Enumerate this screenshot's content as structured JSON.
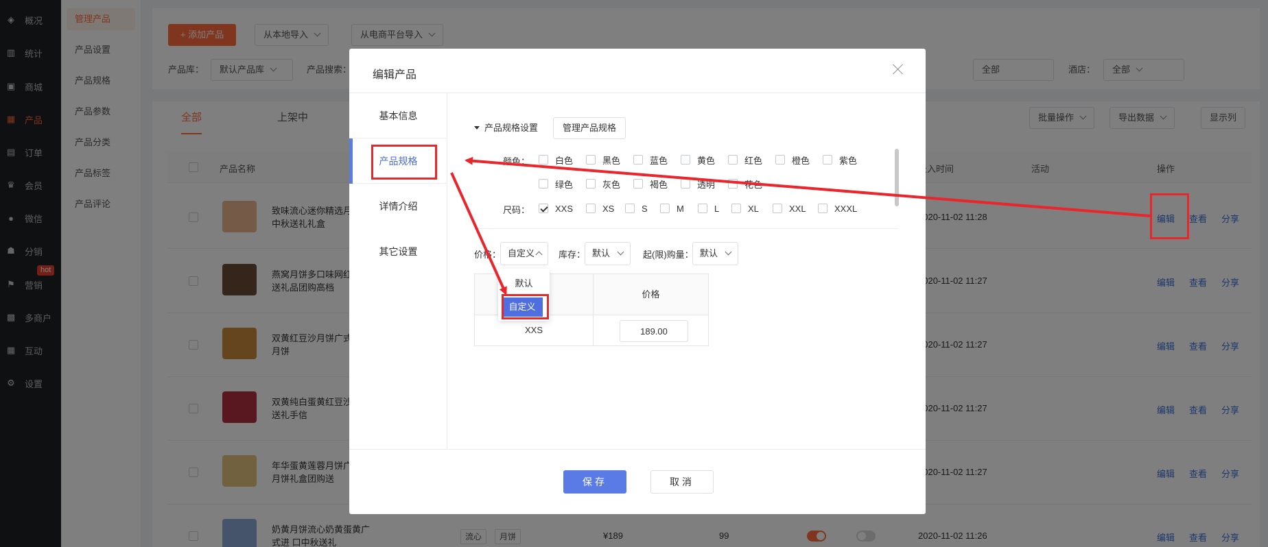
{
  "sidebar": {
    "items": [
      {
        "label": "概况",
        "icon": "layers-icon"
      },
      {
        "label": "统计",
        "icon": "chart-icon"
      },
      {
        "label": "商城",
        "icon": "shop-icon"
      },
      {
        "label": "产品",
        "icon": "grid-icon"
      },
      {
        "label": "订单",
        "icon": "order-icon"
      },
      {
        "label": "会员",
        "icon": "crown-icon"
      },
      {
        "label": "微信",
        "icon": "wechat-icon"
      },
      {
        "label": "分销",
        "icon": "users-icon"
      },
      {
        "label": "营销",
        "icon": "flag-icon"
      },
      {
        "label": "多商户",
        "icon": "store-icon"
      },
      {
        "label": "互动",
        "icon": "grid-icon"
      },
      {
        "label": "设置",
        "icon": "gear-icon"
      }
    ],
    "hot_badge": "hot"
  },
  "subnav": {
    "items": [
      "管理产品",
      "产品设置",
      "产品规格",
      "产品参数",
      "产品分类",
      "产品标签",
      "产品评论"
    ]
  },
  "toolbar": {
    "add_label": "+ 添加产品",
    "import_local": "从本地导入",
    "import_ecom": "从电商平台导入"
  },
  "filters": {
    "lib_label": "产品库：",
    "lib_value": "默认产品库",
    "search_label": "产品搜索：",
    "all_value": "全部",
    "hotel_label": "酒店：",
    "hotel_value": "全部"
  },
  "tabs": [
    "全部",
    "上架中"
  ],
  "list_actions": {
    "batch": "批量操作",
    "export": "导出数据",
    "columns": "显示列"
  },
  "table": {
    "headers": {
      "name": "产品名称",
      "time": "录入时间",
      "activity": "活动",
      "ops": "操作"
    },
    "time_prefix_hidden": "录",
    "rows": [
      {
        "name": "致味流心迷你精选月饼 蓉中秋送礼礼盒",
        "time": "2020-11-02 11:28"
      },
      {
        "name": "燕窝月饼多口味网红 月饼送礼品团购高档",
        "time": "2020-11-02 11:27"
      },
      {
        "name": "双黄红豆沙月饼广式 中秋月饼",
        "time": "2020-11-02 11:27"
      },
      {
        "name": "双黄纯白蛋黄红豆沙 中秋送礼手信",
        "time": "2020-11-02 11:27"
      },
      {
        "name": "年华蛋黄莲蓉月饼广 中秋月饼礼盒团购送",
        "time": "2020-11-02 11:27"
      },
      {
        "name": "奶黄月饼流心奶黄蛋黄广式进 口中秋送礼",
        "time": "2020-11-02 11:26",
        "tags": [
          "流心",
          "月饼"
        ],
        "price": "¥189",
        "stock": "99"
      }
    ],
    "ops": {
      "edit": "编辑",
      "view": "查看",
      "share": "分享"
    }
  },
  "modal": {
    "title": "编辑产品",
    "tabs": [
      "基本信息",
      "产品规格",
      "详情介绍",
      "其它设置"
    ],
    "spec_title": "产品规格设置",
    "manage_btn": "管理产品规格",
    "color_label": "颜色：",
    "colors": [
      "白色",
      "黑色",
      "蓝色",
      "黄色",
      "红色",
      "橙色",
      "紫色",
      "绿色",
      "灰色",
      "褐色",
      "透明",
      "花色"
    ],
    "size_label": "尺码：",
    "sizes": [
      {
        "label": "XXS",
        "checked": true
      },
      {
        "label": "XS",
        "checked": false
      },
      {
        "label": "S",
        "checked": false
      },
      {
        "label": "M",
        "checked": false
      },
      {
        "label": "L",
        "checked": false
      },
      {
        "label": "XL",
        "checked": false
      },
      {
        "label": "XXL",
        "checked": false
      },
      {
        "label": "XXXL",
        "checked": false
      }
    ],
    "price_label": "价格：",
    "price_mode": "自定义",
    "stock_label": "库存：",
    "stock_mode": "默认",
    "moq_label": "起(限)购量：",
    "moq_mode": "默认",
    "dropdown_options": [
      "默认",
      "自定义"
    ],
    "table_header_price": "价格",
    "table_rows": [
      {
        "size": "XXS",
        "price": "189.00"
      }
    ],
    "save": "保存",
    "cancel": "取消"
  },
  "colors": {
    "accent": "#ff6a3c",
    "modal_blue": "#5a7be5",
    "annotation_red": "#e8262c"
  }
}
